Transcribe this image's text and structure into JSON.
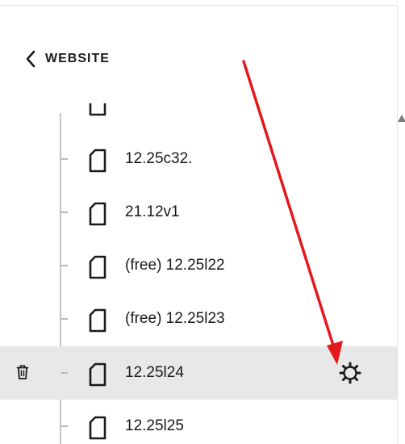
{
  "header": {
    "back_label": "WEBSITE"
  },
  "pages": [
    {
      "label": "12.25c32."
    },
    {
      "label": "21.12v1"
    },
    {
      "label": "(free) 12.25l22"
    },
    {
      "label": "(free) 12.25l23"
    },
    {
      "label": "12.25l24",
      "selected": true
    },
    {
      "label": "12.25l25"
    }
  ],
  "colors": {
    "text": "#1a1a1a",
    "selected_row_bg": "#e8e8e8",
    "tree_line": "#c4c4c4",
    "annotation_arrow": "#e3191c"
  },
  "icons": {
    "back": "chevron-left-icon",
    "page": "page-icon",
    "delete": "trash-icon",
    "settings": "gear-icon"
  }
}
